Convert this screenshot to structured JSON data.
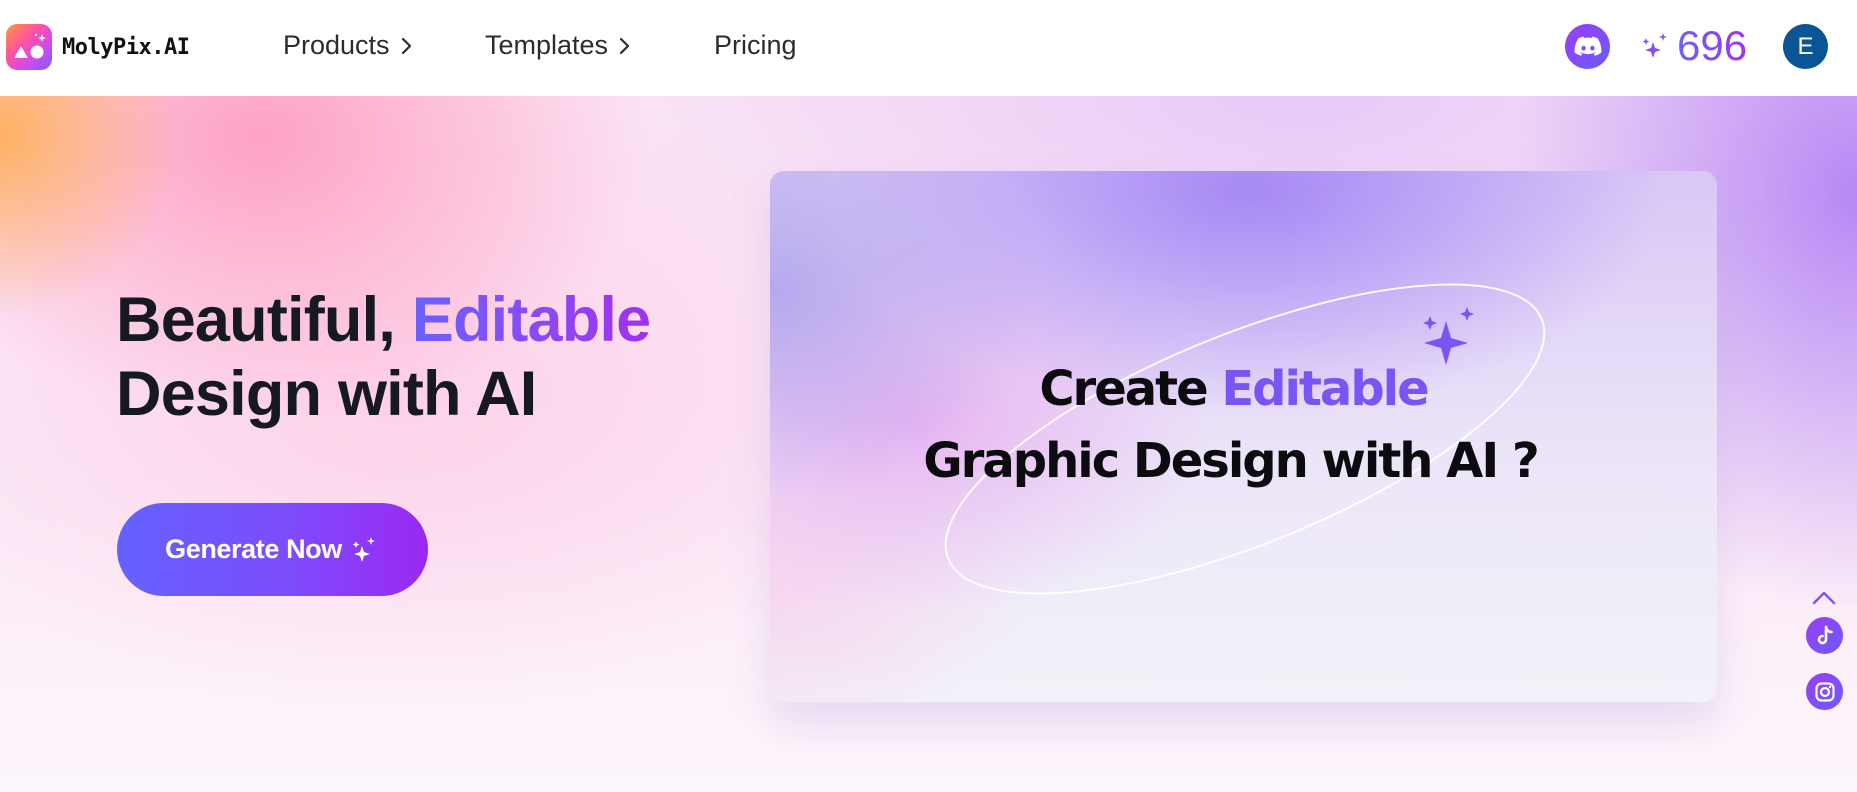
{
  "brand": {
    "name": "MolyPix.AI",
    "logo_icon": "molypix-logo-icon"
  },
  "nav": {
    "items": [
      {
        "label": "Products",
        "has_submenu": true,
        "icon": "chevron-right-icon"
      },
      {
        "label": "Templates",
        "has_submenu": true,
        "icon": "chevron-right-icon"
      },
      {
        "label": "Pricing",
        "has_submenu": false
      }
    ]
  },
  "header_actions": {
    "discord_icon": "discord-icon",
    "credits_icon": "sparkles-icon",
    "credits": "696",
    "avatar_initial": "E"
  },
  "hero": {
    "title_part1": "Beautiful, ",
    "title_accent": "Editable",
    "title_part2": "Design with AI",
    "cta_label": "Generate Now",
    "cta_icon": "sparkles-icon"
  },
  "preview": {
    "line1_part1": "Create ",
    "line1_accent": "Editable",
    "line2": "Graphic Design with AI ?"
  },
  "side_actions": {
    "scroll_top_icon": "chevron-up-icon",
    "social": [
      {
        "name": "TikTok",
        "icon": "tiktok-icon"
      },
      {
        "name": "Instagram",
        "icon": "instagram-icon"
      }
    ]
  },
  "colors": {
    "accent_start": "#6462FF",
    "accent_end": "#9B28F2",
    "avatar_bg": "#0B5496",
    "text_dark": "#16191F"
  }
}
